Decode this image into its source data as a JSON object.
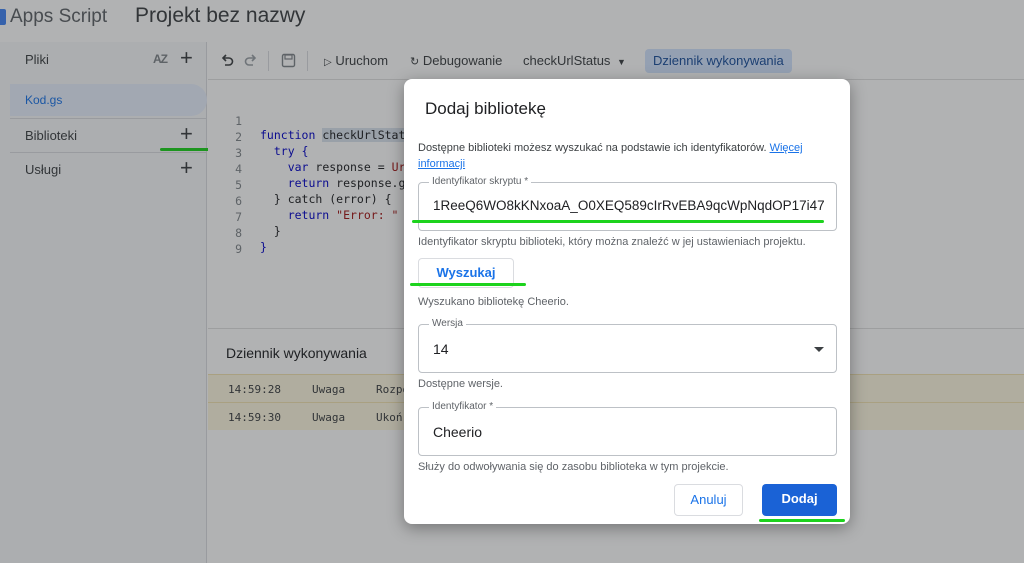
{
  "header": {
    "app_name": "Apps Script",
    "project_name": "Projekt bez nazwy"
  },
  "sidebar": {
    "files_label": "Pliki",
    "sort_icon_text": "AZ",
    "file_item": "Kod.gs",
    "libraries_label": "Biblioteki",
    "services_label": "Usługi",
    "plus": "+"
  },
  "toolbar": {
    "run_label": "Uruchom",
    "debug_label": "Debugowanie",
    "function_select": "checkUrlStatus",
    "log_button": "Dziennik wykonywania"
  },
  "editor": {
    "line_numbers": [
      "1",
      "2",
      "3",
      "4",
      "5",
      "6",
      "7",
      "8",
      "9"
    ],
    "lines": {
      "l1_kw": "function ",
      "l1_fn": "checkUrlStat",
      "l2": "  try {",
      "l3_kw": "    var ",
      "l3_rest": "response = ",
      "l3_str": "Ur",
      "l4_kw": "    return ",
      "l4_rest": "response.g",
      "l5": "  } catch (error) {",
      "l6_kw": "    return ",
      "l6_str": "\"Error: \"",
      "l7": "  }",
      "l8": "}"
    }
  },
  "log": {
    "title": "Dziennik wykonywania",
    "rows": [
      {
        "time": "14:59:28",
        "level": "Uwaga",
        "message": "Rozpo"
      },
      {
        "time": "14:59:30",
        "level": "Uwaga",
        "message": "Ukoń"
      }
    ]
  },
  "dialog": {
    "title": "Dodaj bibliotekę",
    "description": "Dostępne biblioteki możesz wyszukać na podstawie ich identyfikatorów. ",
    "more_info_link": "Więcej informacji",
    "script_id_label": "Identyfikator skryptu *",
    "script_id_value": "1ReeQ6WO8kKNxoaA_O0XEQ589cIrRvEBA9qcWpNqdOP17i47",
    "script_id_helper": "Identyfikator skryptu biblioteki, który można znaleźć w jej ustawieniach projektu.",
    "search_button": "Wyszukaj",
    "search_result": "Wyszukano bibliotekę Cheerio.",
    "version_label": "Wersja",
    "version_value": "14",
    "version_helper": "Dostępne wersje.",
    "identifier_label": "Identyfikator *",
    "identifier_value": "Cheerio",
    "identifier_helper": "Służy do odwoływania się do zasobu biblioteka w tym projekcie.",
    "cancel_button": "Anuluj",
    "add_button": "Dodaj"
  },
  "colors": {
    "accent": "#1a73e8",
    "primary_button": "#1a62d6",
    "highlight_mark": "#1dd31d",
    "log_warning_bg": "#fef7e0"
  }
}
